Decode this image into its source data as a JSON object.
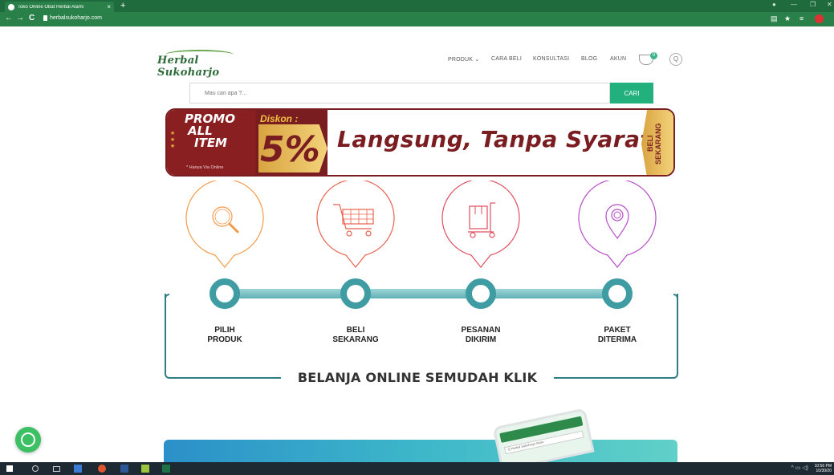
{
  "browser": {
    "tab_title": "Toko Online Obat Herbal Alami",
    "tab_close": "×",
    "new_tab": "+",
    "url": "herbalsukoharjo.com",
    "back": "←",
    "forward": "→",
    "reload": "C",
    "window_controls": [
      "—",
      "❐",
      "✕"
    ]
  },
  "site": {
    "logo": "Herbal Sukoharjo",
    "nav": [
      {
        "label": "PRODUK ⌄"
      },
      {
        "label": "CARA BELI"
      },
      {
        "label": "KONSULTASI"
      },
      {
        "label": "BLOG"
      },
      {
        "label": "AKUN"
      }
    ],
    "cart_count": "0",
    "search_icon_glyph": "Q"
  },
  "search": {
    "placeholder": "Mau cari apa ?...",
    "button": "CARI"
  },
  "banner": {
    "promo_line1": "PROMO",
    "promo_line2": "ALL",
    "promo_line3": "ITEM",
    "promo_note": "* Hanya Via Online",
    "diskon_label": "Diskon :",
    "diskon_value": "5%",
    "headline": "Langsung, Tanpa Syarat",
    "cta": "BELI SEKARANG",
    "stars": "★★★"
  },
  "steps": {
    "title": "BELANJA ONLINE SEMUDAH KLIK",
    "items": [
      {
        "line1": "PILIH",
        "line2": "PRODUK",
        "icon": "magnifier-icon",
        "color": "#f39a4a"
      },
      {
        "line1": "BELI",
        "line2": "SEKARANG",
        "icon": "cart-icon",
        "color": "#e8624e"
      },
      {
        "line1": "PESANAN",
        "line2": "DIKIRIM",
        "icon": "package-icon",
        "color": "#e04e5e"
      },
      {
        "line1": "PAKET",
        "line2": "DITERIMA",
        "icon": "location-pin-icon",
        "color": "#b64cc7"
      }
    ]
  },
  "bottom": {
    "phone_search": "Q  Herbal Sukoharjo Store"
  },
  "taskbar": {
    "time": "10:56 PM",
    "date": "10/30/20"
  },
  "colors": {
    "brand_green": "#2a8049",
    "accent_teal": "#22b07d",
    "banner_maroon": "#7a1d20",
    "frame_teal": "#2e7c86"
  }
}
